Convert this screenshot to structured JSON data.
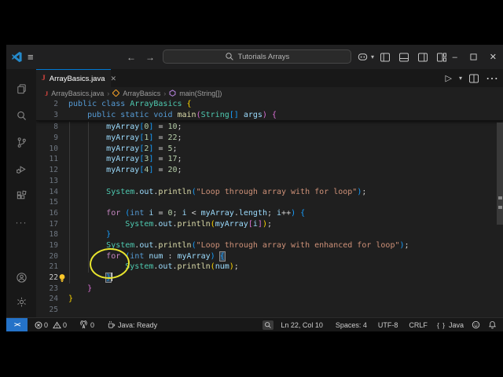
{
  "titlebar": {
    "search_label": "Tutorials Arrays",
    "menu_glyph": "≡",
    "back_glyph": "←",
    "forward_glyph": "→",
    "minimize_glyph": "–",
    "close_glyph": "✕"
  },
  "tabs": [
    {
      "label": "ArrayBasics.java",
      "close_glyph": "✕",
      "file_badge": "J"
    }
  ],
  "editor_actions": {
    "run_glyph": "▷",
    "run_dropdown_glyph": "▾",
    "more_glyph": "⋯"
  },
  "breadcrumb": {
    "file": "ArrayBasics.java",
    "class": "ArrayBasics",
    "symbol": "main(String[])",
    "sep": "›"
  },
  "activitybar_ellipsis": "···",
  "colors": {
    "accent_blue": "#0078d4",
    "remote_badge_blue": "#2472c8",
    "annotation_yellow": "#e8e52e",
    "java_file_red": "#d6453f",
    "class_icon_orange": "#ee9d28",
    "method_icon_purple": "#b180d7",
    "editor_bg": "#1f1f1f",
    "chrome_bg": "#181818"
  },
  "syntax_colors": {
    "keyword": "#569cd6",
    "control": "#c586c0",
    "type": "#4ec9b0",
    "function": "#dcdcaa",
    "variable": "#9cdcfe",
    "number": "#b5cea8",
    "string": "#ce9178",
    "punctuation": "#d4d4d4",
    "bracket1": "#ffd700",
    "bracket2": "#da70d6",
    "bracket3": "#179fff"
  },
  "editor": {
    "sticky": [
      {
        "n": 2,
        "tokens": [
          [
            "public class ",
            "kw"
          ],
          [
            "ArrayBasics",
            "type"
          ],
          [
            " ",
            "ws"
          ],
          [
            "{",
            "b1"
          ]
        ]
      },
      {
        "n": 3,
        "tokens": [
          [
            "    ",
            "ws"
          ],
          [
            "public static void ",
            "kw"
          ],
          [
            "main",
            "fn"
          ],
          [
            "(",
            "b2"
          ],
          [
            "String",
            "type"
          ],
          [
            "[]",
            "b3"
          ],
          [
            " ",
            "ws"
          ],
          [
            "args",
            "var"
          ],
          [
            ")",
            "b2"
          ],
          [
            " ",
            "ws"
          ],
          [
            "{",
            "b2"
          ]
        ]
      }
    ],
    "lines": [
      {
        "n": 8,
        "tokens": [
          [
            "        ",
            "ws"
          ],
          [
            "myArray",
            "var"
          ],
          [
            "[",
            "b3"
          ],
          [
            "0",
            "num"
          ],
          [
            "]",
            "b3"
          ],
          [
            " = ",
            "pun"
          ],
          [
            "10",
            "num"
          ],
          [
            ";",
            "pun"
          ]
        ]
      },
      {
        "n": 9,
        "tokens": [
          [
            "        ",
            "ws"
          ],
          [
            "myArray",
            "var"
          ],
          [
            "[",
            "b3"
          ],
          [
            "1",
            "num"
          ],
          [
            "]",
            "b3"
          ],
          [
            " = ",
            "pun"
          ],
          [
            "22",
            "num"
          ],
          [
            ";",
            "pun"
          ]
        ]
      },
      {
        "n": 10,
        "tokens": [
          [
            "        ",
            "ws"
          ],
          [
            "myArray",
            "var"
          ],
          [
            "[",
            "b3"
          ],
          [
            "2",
            "num"
          ],
          [
            "]",
            "b3"
          ],
          [
            " = ",
            "pun"
          ],
          [
            "5",
            "num"
          ],
          [
            ";",
            "pun"
          ]
        ]
      },
      {
        "n": 11,
        "tokens": [
          [
            "        ",
            "ws"
          ],
          [
            "myArray",
            "var"
          ],
          [
            "[",
            "b3"
          ],
          [
            "3",
            "num"
          ],
          [
            "]",
            "b3"
          ],
          [
            " = ",
            "pun"
          ],
          [
            "17",
            "num"
          ],
          [
            ";",
            "pun"
          ]
        ]
      },
      {
        "n": 12,
        "tokens": [
          [
            "        ",
            "ws"
          ],
          [
            "myArray",
            "var"
          ],
          [
            "[",
            "b3"
          ],
          [
            "4",
            "num"
          ],
          [
            "]",
            "b3"
          ],
          [
            " = ",
            "pun"
          ],
          [
            "20",
            "num"
          ],
          [
            ";",
            "pun"
          ]
        ]
      },
      {
        "n": 13,
        "tokens": []
      },
      {
        "n": 14,
        "tokens": [
          [
            "        ",
            "ws"
          ],
          [
            "System",
            "type"
          ],
          [
            ".",
            "pun"
          ],
          [
            "out",
            "var"
          ],
          [
            ".",
            "pun"
          ],
          [
            "println",
            "fn"
          ],
          [
            "(",
            "b3"
          ],
          [
            "\"Loop through array with for loop\"",
            "str"
          ],
          [
            ")",
            "b3"
          ],
          [
            ";",
            "pun"
          ]
        ]
      },
      {
        "n": 15,
        "tokens": []
      },
      {
        "n": 16,
        "tokens": [
          [
            "        ",
            "ws"
          ],
          [
            "for",
            "ctrl"
          ],
          [
            " ",
            "ws"
          ],
          [
            "(",
            "b3"
          ],
          [
            "int",
            "kw"
          ],
          [
            " ",
            "ws"
          ],
          [
            "i",
            "var"
          ],
          [
            " = ",
            "pun"
          ],
          [
            "0",
            "num"
          ],
          [
            "; ",
            "pun"
          ],
          [
            "i",
            "var"
          ],
          [
            " < ",
            "pun"
          ],
          [
            "myArray",
            "var"
          ],
          [
            ".",
            "pun"
          ],
          [
            "length",
            "var"
          ],
          [
            "; ",
            "pun"
          ],
          [
            "i",
            "var"
          ],
          [
            "++",
            "pun"
          ],
          [
            ")",
            "b3"
          ],
          [
            " ",
            "ws"
          ],
          [
            "{",
            "b3"
          ]
        ]
      },
      {
        "n": 17,
        "tokens": [
          [
            "            ",
            "ws"
          ],
          [
            "System",
            "type"
          ],
          [
            ".",
            "pun"
          ],
          [
            "out",
            "var"
          ],
          [
            ".",
            "pun"
          ],
          [
            "println",
            "fn"
          ],
          [
            "(",
            "b1"
          ],
          [
            "myArray",
            "var"
          ],
          [
            "[",
            "b2"
          ],
          [
            "i",
            "var"
          ],
          [
            "]",
            "b2"
          ],
          [
            ")",
            "b1"
          ],
          [
            ";",
            "pun"
          ]
        ]
      },
      {
        "n": 18,
        "tokens": [
          [
            "        ",
            "ws"
          ],
          [
            "}",
            "b3"
          ]
        ]
      },
      {
        "n": 19,
        "tokens": [
          [
            "        ",
            "ws"
          ],
          [
            "System",
            "type"
          ],
          [
            ".",
            "pun"
          ],
          [
            "out",
            "var"
          ],
          [
            ".",
            "pun"
          ],
          [
            "println",
            "fn"
          ],
          [
            "(",
            "b3"
          ],
          [
            "\"Loop through array with enhanced for loop\"",
            "str"
          ],
          [
            ")",
            "b3"
          ],
          [
            ";",
            "pun"
          ]
        ]
      },
      {
        "n": 20,
        "tokens": [
          [
            "        ",
            "ws"
          ],
          [
            "for",
            "ctrl"
          ],
          [
            " ",
            "ws"
          ],
          [
            "(",
            "b3"
          ],
          [
            "int",
            "kw"
          ],
          [
            " ",
            "ws"
          ],
          [
            "num",
            "var"
          ],
          [
            " : ",
            "pun"
          ],
          [
            "myArray",
            "var"
          ],
          [
            ")",
            "b3"
          ],
          [
            " ",
            "ws"
          ],
          [
            "{",
            "b3m"
          ]
        ]
      },
      {
        "n": 21,
        "tokens": [
          [
            "            ",
            "ws"
          ],
          [
            "System",
            "type"
          ],
          [
            ".",
            "pun"
          ],
          [
            "out",
            "var"
          ],
          [
            ".",
            "pun"
          ],
          [
            "println",
            "fn"
          ],
          [
            "(",
            "b1"
          ],
          [
            "num",
            "var"
          ],
          [
            ")",
            "b1"
          ],
          [
            ";",
            "pun"
          ]
        ]
      },
      {
        "n": 22,
        "tokens": [
          [
            "        ",
            "ws"
          ],
          [
            "}",
            "b3m"
          ]
        ],
        "active": true,
        "cursor": true,
        "bulb": true
      },
      {
        "n": 23,
        "tokens": [
          [
            "    ",
            "ws"
          ],
          [
            "}",
            "b2"
          ]
        ]
      },
      {
        "n": 24,
        "tokens": [
          [
            "}",
            "b1"
          ]
        ]
      },
      {
        "n": 25,
        "tokens": []
      }
    ]
  },
  "statusbar": {
    "errors": "0",
    "warnings": "0",
    "ports": "0",
    "java_status": "Java: Ready",
    "cursor_position": "Ln 22, Col 10",
    "indentation": "Spaces: 4",
    "encoding": "UTF-8",
    "eol": "CRLF",
    "language_braces": "{ }",
    "language": "Java",
    "remote_glyph": "><"
  }
}
